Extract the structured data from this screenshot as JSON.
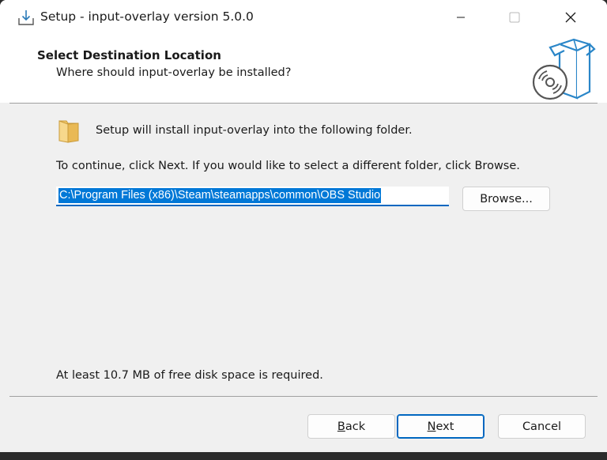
{
  "window": {
    "title": "Setup - input-overlay version 5.0.0"
  },
  "header": {
    "title": "Select Destination Location",
    "subtitle": "Where should input-overlay be installed?"
  },
  "main": {
    "install_text": "Setup will install input-overlay into the following folder.",
    "continue_text": "To continue, click Next. If you would like to select a different folder, click Browse.",
    "path_value": "C:\\Program Files (x86)\\Steam\\steamapps\\common\\OBS Studio",
    "browse_label": "Browse...",
    "disk_space_text": "At least 10.7 MB of free disk space is required."
  },
  "footer": {
    "back_label": "Back",
    "back_access_key": "B",
    "back_rest": "ack",
    "next_label": "Next",
    "next_access_key": "N",
    "next_rest": "ext",
    "cancel_label": "Cancel"
  },
  "colors": {
    "accent": "#0067c0",
    "selection": "#0078d7",
    "background": "#f0f0f0"
  },
  "icons": {
    "title": "installer-download-icon",
    "header": "software-box-disc-icon",
    "folder": "folder-icon"
  }
}
